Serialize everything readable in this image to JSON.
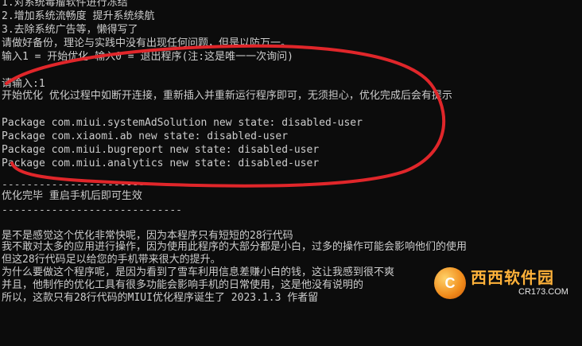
{
  "console": {
    "lines": [
      "1.对系统毒瘤软件进行冻结",
      "2.增加系统流畅度 提升系统续航",
      "3.去除系统广告等，懒得写了",
      "请做好备份，理论与实践中没有出现任何问题，但是以防万一。",
      "输入1 = 开始优化 输入0 = 退出程序(注:这是唯一一次询问)",
      "",
      "请输入:1",
      "开始优化 优化过程中如断开连接，重新插入并重新运行程序即可，无须担心，优化完成后会有提示",
      "",
      "Package com.miui.systemAdSolution new state: disabled-user",
      "Package com.xiaomi.ab new state: disabled-user",
      "Package com.miui.bugreport new state: disabled-user",
      "Package com.miui.analytics new state: disabled-user",
      "",
      "-----------------------------",
      "优化完毕 重启手机后即可生效",
      "-----------------------------",
      "",
      "是不是感觉这个优化非常快呢，因为本程序只有短短的28行代码",
      "我不敢对太多的应用进行操作，因为使用此程序的大部分都是小白，过多的操作可能会影响他们的使用",
      "但这28行代码足以给您的手机带来很大的提升。",
      "为什么要做这个程序呢，是因为看到了雪车利用信息差赚小白的钱，这让我感到很不爽",
      "并且，他制作的优化工具有很多功能会影响手机的日常使用，这是他没有说明的",
      "所以，这款只有28行代码的MIUI优化程序诞生了 2023.1.3 作者留"
    ]
  },
  "annotation": {
    "color": "#e0262a"
  },
  "watermark": {
    "logo_glyph": "C",
    "title": "西西软件园",
    "url": "CR173.COM"
  }
}
